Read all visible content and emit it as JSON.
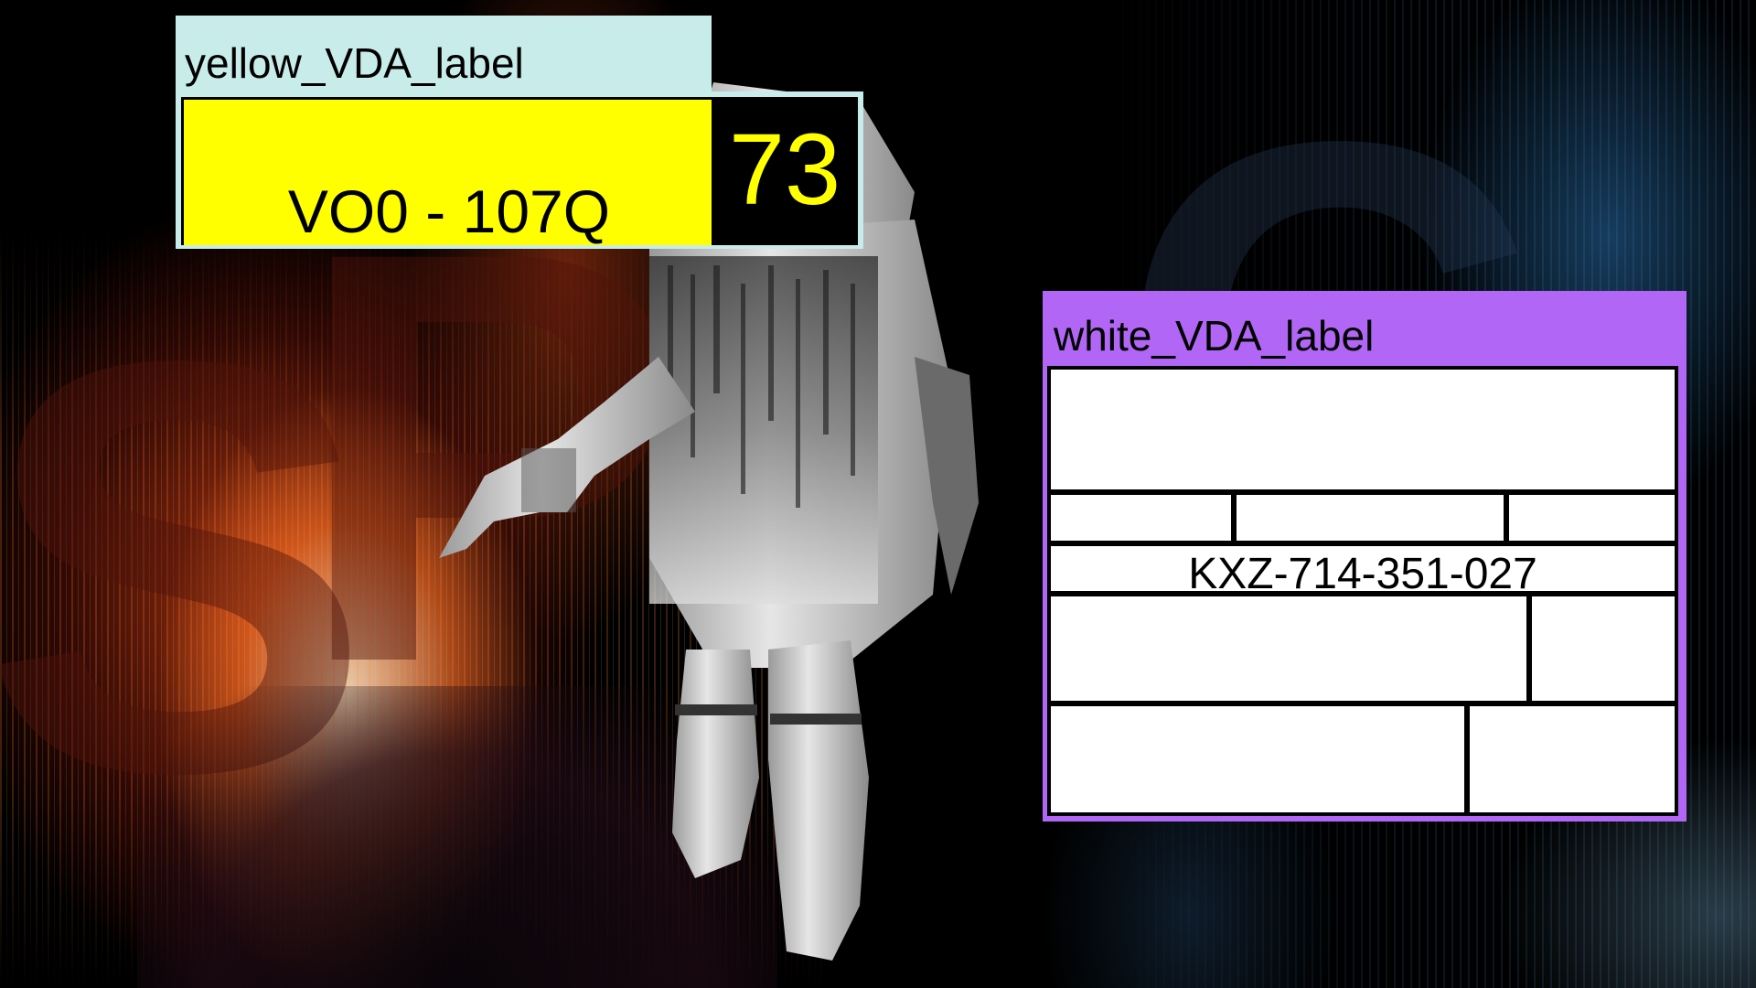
{
  "yellow_label": {
    "title": "yellow_VDA_label",
    "code": "VO0 - 107Q",
    "number": "73"
  },
  "white_label": {
    "title": "white_VDA_label",
    "code": "KXZ-714-351-027"
  },
  "colors": {
    "yellow_header_bg": "#c7ecea",
    "yellow_field": "#ffff00",
    "number_bg": "#000000",
    "number_text": "#ffff00",
    "white_header_bg": "#b266f5",
    "white_field": "#ffffff"
  },
  "background": {
    "theme": "astronaut floating in front of glitch-streak space backdrop"
  }
}
